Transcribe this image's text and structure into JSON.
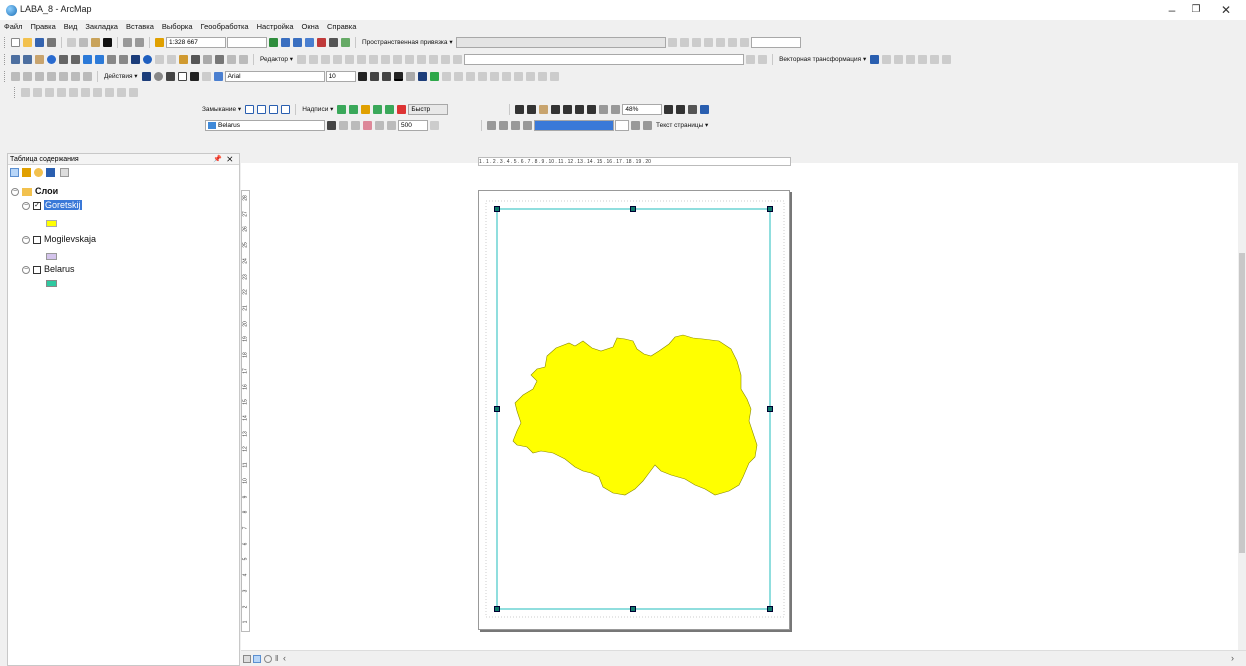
{
  "window": {
    "title": "LABA_8 - ArcMap",
    "minimize": "–",
    "maximize": "❐",
    "close": "✕"
  },
  "menu": [
    "Файл",
    "Правка",
    "Вид",
    "Закладка",
    "Вставка",
    "Выборка",
    "Геообработка",
    "Настройка",
    "Окна",
    "Справка"
  ],
  "toolbars": {
    "scale_value": "1:328 667",
    "snapping_label": "Пространственная привязка ▾",
    "editor_label": "Редактор ▾",
    "vector_transform_label": "Векторная трансформация ▾",
    "actions_label": "Действия ▾",
    "font_name": "Arial",
    "font_size": "10",
    "snap_label": "Замыкание ▾",
    "labels_label": "Надписи ▾",
    "fast_label": "Быстр",
    "zoom_percent": "48%",
    "layer_select": "Belarus",
    "buffer_value": "500",
    "page_text_label": "Текст страницы ▾"
  },
  "toc": {
    "title": "Таблица содержания",
    "close_glyph": "⨯",
    "root_label": "Слои",
    "layers": [
      {
        "name": "Goretskij",
        "checked": true,
        "swatch_color": "#ffff00"
      },
      {
        "name": "Mogilevskaja",
        "checked": false,
        "swatch_color": "#d4c4ec"
      },
      {
        "name": "Belarus",
        "checked": false,
        "swatch_color": "#2ec9a0"
      }
    ]
  },
  "ruler_top_labels": "1 . 1 . 2 . 3 . 4 . 5 . 6 . 7 . 8 . 9 . 10 . 11 . 12 . 13 . 14 . 15 . 16 . 17 . 18 . 19 . 20",
  "ruler_left_labels": [
    "28",
    "27",
    "26",
    "25",
    "24",
    "23",
    "22",
    "21",
    "20",
    "19",
    "18",
    "17",
    "16",
    "15",
    "14",
    "13",
    "12",
    "11",
    "10",
    "9",
    "8",
    "7",
    "6",
    "5",
    "4",
    "3",
    "2",
    "1"
  ],
  "colors": {
    "map_fill": "#ffff00",
    "frame": "#45c7c7",
    "selection_bg": "#3a79d8"
  }
}
